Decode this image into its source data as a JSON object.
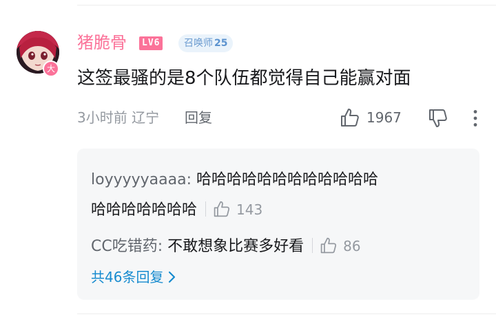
{
  "comment": {
    "username": "猪脆骨",
    "level": "LV6",
    "title_badge": {
      "label": "召唤师",
      "number": "25"
    },
    "avatar_badge": "大",
    "text": "这签最骚的是8个队伍都觉得自己能赢对面",
    "time": "3小时前",
    "location": "辽宁",
    "reply_label": "回复",
    "like_count": "1967"
  },
  "replies": [
    {
      "user": "loyyyyyaaaa:",
      "text_line1": "哈哈哈哈哈哈哈哈哈哈哈哈",
      "text_line2": "哈哈哈哈哈哈哈",
      "likes": "143"
    },
    {
      "user": "CC吃错药:",
      "text": "不敢想象比赛多好看",
      "likes": "86"
    }
  ],
  "more_replies": "共46条回复",
  "colors": {
    "accent_pink": "#fb7299",
    "link_blue": "#178bcf",
    "panel_bg": "#f6f7f8"
  },
  "icons": [
    "thumbs-up-icon",
    "thumbs-down-icon",
    "more-vertical-icon",
    "chevron-right-icon"
  ]
}
